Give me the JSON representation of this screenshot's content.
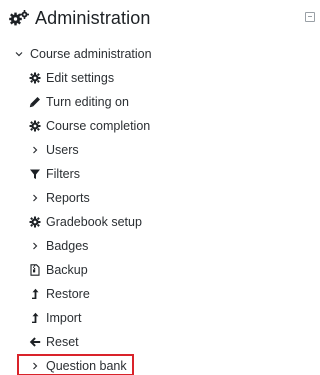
{
  "header": {
    "title": "Administration",
    "icon": "cogs-icon"
  },
  "tree": {
    "root": {
      "label": "Course administration",
      "icon": "chevron-down-icon"
    },
    "items": [
      {
        "label": "Edit settings",
        "icon": "cog-icon"
      },
      {
        "label": "Turn editing on",
        "icon": "pencil-icon"
      },
      {
        "label": "Course completion",
        "icon": "cog-icon"
      },
      {
        "label": "Users",
        "icon": "chevron-right-icon"
      },
      {
        "label": "Filters",
        "icon": "filter-icon"
      },
      {
        "label": "Reports",
        "icon": "chevron-right-icon"
      },
      {
        "label": "Gradebook setup",
        "icon": "cog-icon"
      },
      {
        "label": "Badges",
        "icon": "chevron-right-icon"
      },
      {
        "label": "Backup",
        "icon": "file-archive-icon"
      },
      {
        "label": "Restore",
        "icon": "level-up-icon"
      },
      {
        "label": "Import",
        "icon": "level-up-icon"
      },
      {
        "label": "Reset",
        "icon": "arrow-left-icon"
      },
      {
        "label": "Question bank",
        "icon": "chevron-right-icon"
      }
    ]
  },
  "colors": {
    "text": "#2b2f33",
    "icon": "#1d2125",
    "highlight": "#d9232a"
  }
}
